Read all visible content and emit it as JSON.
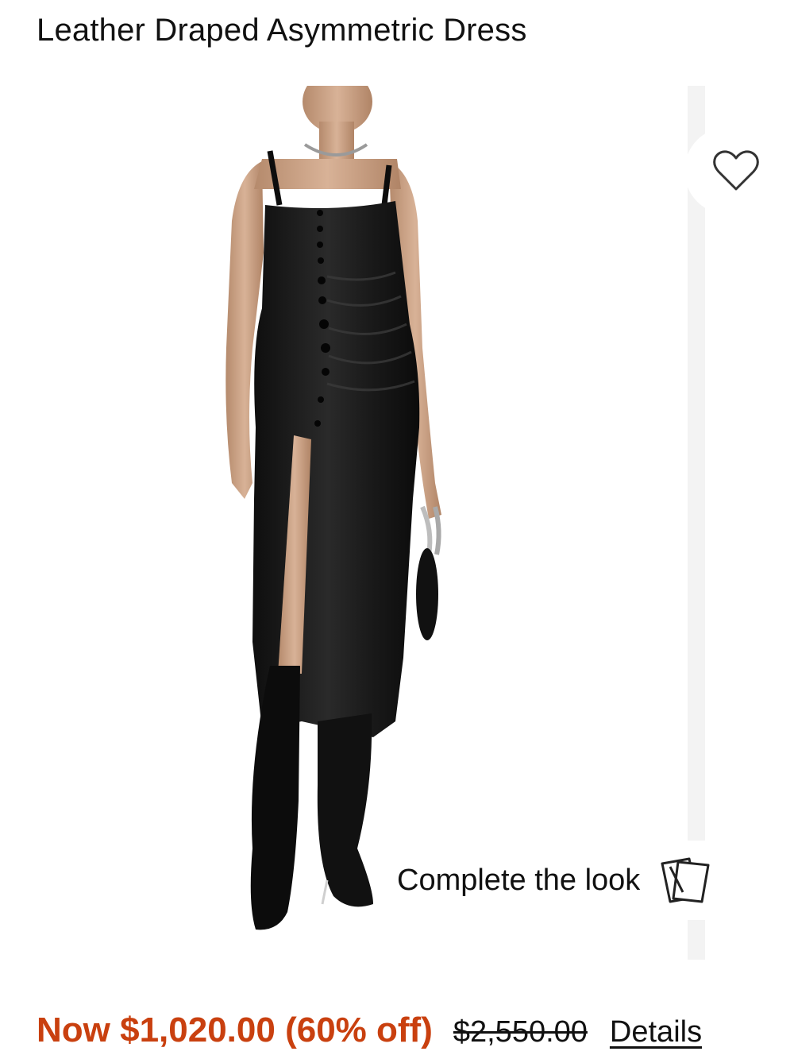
{
  "product": {
    "title": "Leather Draped Asymmetric Dress"
  },
  "gallery": {
    "favorite_icon": "heart-outline-icon",
    "complete_the_look_label": "Complete the look",
    "complete_the_look_icon": "cards-icon"
  },
  "pricing": {
    "now_text": "Now $1,020.00 (60% off)",
    "original_price": "$2,550.00",
    "details_label": "Details",
    "sale_color": "#c9400f"
  }
}
